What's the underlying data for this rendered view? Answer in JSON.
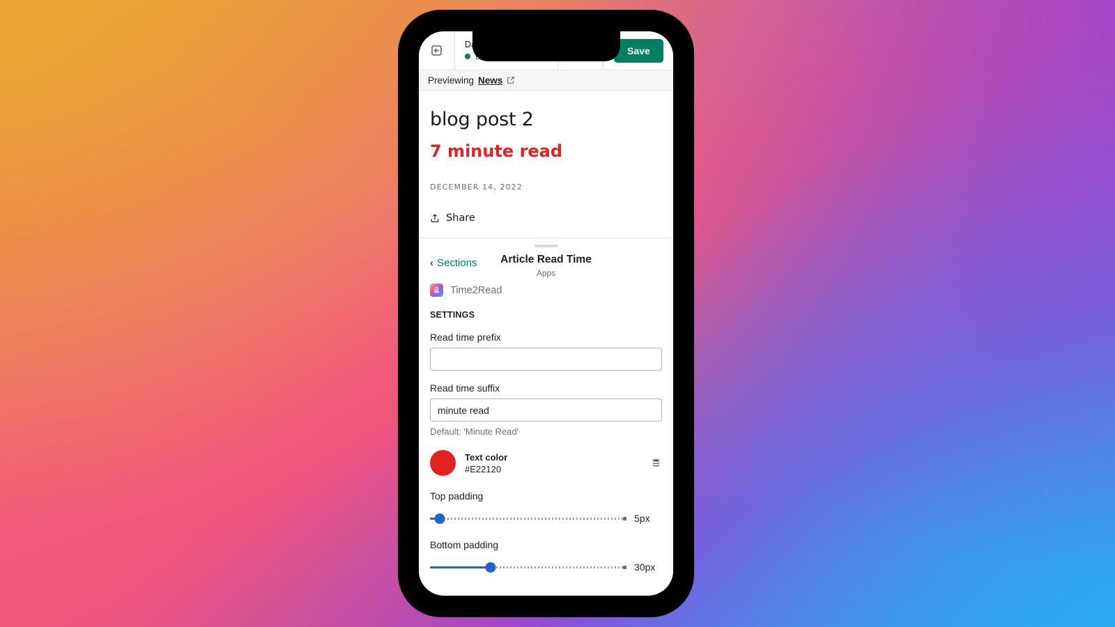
{
  "background": {
    "colors": [
      "#EDA434",
      "#F2557B",
      "#9543D6",
      "#2BA7F0"
    ]
  },
  "topbar": {
    "exit_icon": "exit-icon",
    "theme_name": "Dawn",
    "theme_status": "Dawn",
    "status_dot_color": "#008060",
    "save_label": "Save"
  },
  "previewbar": {
    "label": "Previewing",
    "link": "News",
    "external_icon": "external-link-icon"
  },
  "article": {
    "title": "blog post 2",
    "read_time": "7 minute read",
    "read_time_color": "#E22120",
    "date": "DECEMBER 14, 2022",
    "share_label": "Share",
    "share_icon": "share-icon"
  },
  "sheet": {
    "back_label": "Sections",
    "back_chevron": "‹",
    "title": "Article Read Time",
    "subtitle": "Apps",
    "app_name": "Time2Read",
    "app_icon": "time2read-app-icon",
    "settings_heading": "SETTINGS",
    "fields": [
      {
        "label": "Read time prefix",
        "value": "",
        "placeholder": ""
      },
      {
        "label": "Read time suffix",
        "value": "minute read",
        "placeholder": "",
        "help": "Default: 'Minute Read'"
      }
    ],
    "color": {
      "name": "Text color",
      "hex": "#E22120",
      "source_icon": "database-icon"
    },
    "sliders": [
      {
        "label": "Top padding",
        "value": "5px",
        "percent": 5
      },
      {
        "label": "Bottom padding",
        "value": "30px",
        "percent": 31
      }
    ]
  }
}
